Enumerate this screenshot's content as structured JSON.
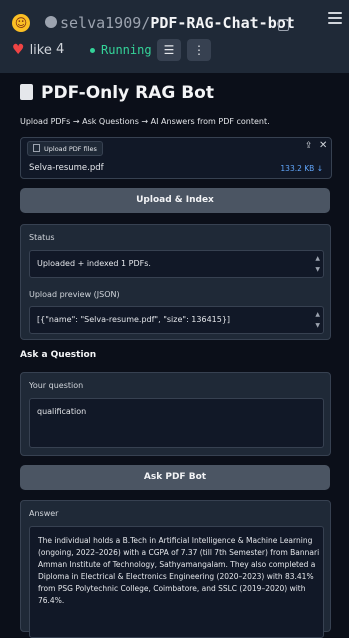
{
  "header": {
    "owner": "selva1909",
    "slash": "/",
    "repo": "PDF-RAG-Chat-bot",
    "like_label": "like",
    "like_count": "4",
    "status": "Running"
  },
  "app": {
    "title": "PDF-Only RAG Bot",
    "subtitle": "Upload PDFs → Ask Questions → AI Answers from PDF content."
  },
  "upload": {
    "label": "Upload PDF files",
    "file_name": "Selva-resume.pdf",
    "file_size": "133.2 KB ↓"
  },
  "buttons": {
    "upload_index": "Upload & Index",
    "ask": "Ask PDF Bot"
  },
  "status": {
    "label": "Status",
    "value": "Uploaded + indexed 1 PDFs."
  },
  "preview": {
    "label": "Upload preview (JSON)",
    "value": "[{\"name\": \"Selva-resume.pdf\", \"size\": 136415}]"
  },
  "question": {
    "section_title": "Ask a Question",
    "label": "Your question",
    "value": "qualification"
  },
  "answer": {
    "label": "Answer",
    "text": "The individual holds a B.Tech in Artificial Intelligence & Machine Learning (ongoing, 2022–2026) with a CGPA of 7.37 (till 7th Semester) from Bannari Amman Institute of Technology, Sathyamangalam. They also completed a Diploma in Electrical & Electronics Engineering (2020–2023) with 83.41% from PSG Polytechnic College, Coimbatore, and SSLC (2019–2020) with 76.4%."
  },
  "colors": {
    "background": "#0b0f19",
    "panel": "#1f2937",
    "button": "#4b5563",
    "running": "#34d399",
    "link": "#60a5fa"
  }
}
